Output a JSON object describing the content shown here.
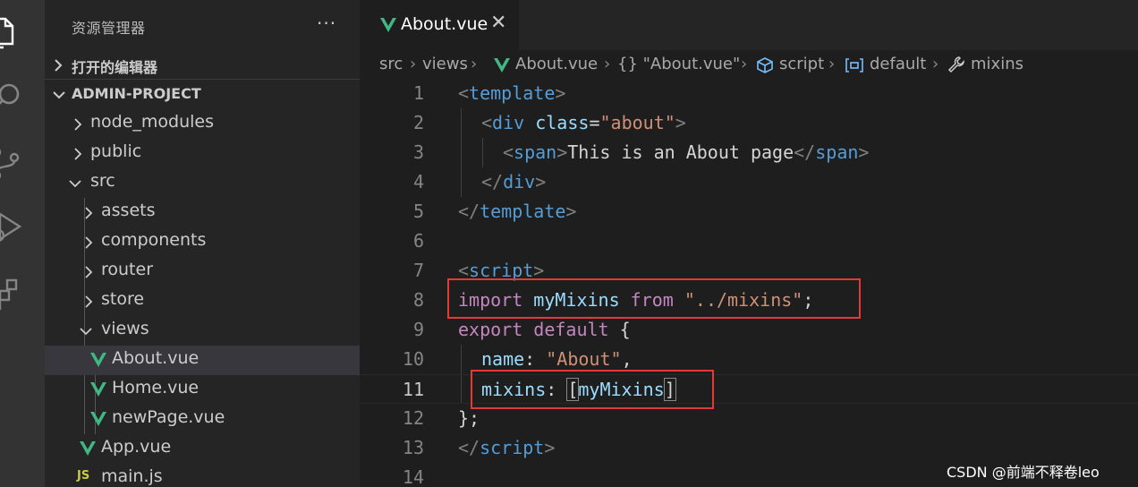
{
  "sidebar": {
    "title": "资源管理器",
    "more": "···",
    "open_editors": "打开的编辑器",
    "project": "ADMIN-PROJECT",
    "tree": [
      {
        "label": "node_modules",
        "type": "folder",
        "expanded": false
      },
      {
        "label": "public",
        "type": "folder",
        "expanded": false
      },
      {
        "label": "src",
        "type": "folder",
        "expanded": true
      },
      {
        "label": "assets",
        "type": "folder",
        "expanded": false
      },
      {
        "label": "components",
        "type": "folder",
        "expanded": false
      },
      {
        "label": "router",
        "type": "folder",
        "expanded": false
      },
      {
        "label": "store",
        "type": "folder",
        "expanded": false
      },
      {
        "label": "views",
        "type": "folder",
        "expanded": true
      },
      {
        "label": "About.vue",
        "type": "vue",
        "selected": true
      },
      {
        "label": "Home.vue",
        "type": "vue"
      },
      {
        "label": "newPage.vue",
        "type": "vue"
      },
      {
        "label": "App.vue",
        "type": "vue"
      },
      {
        "label": "main.js",
        "type": "js",
        "badge": "JS"
      }
    ]
  },
  "tab": {
    "label": "About.vue",
    "close": "✕"
  },
  "breadcrumbs": {
    "items": [
      "src",
      "views",
      "About.vue",
      "{} \"About.vue\"",
      "script",
      "default",
      "mixins"
    ],
    "separator": "›"
  },
  "code": {
    "line_numbers": [
      "1",
      "2",
      "3",
      "4",
      "5",
      "6",
      "7",
      "8",
      "9",
      "10",
      "11",
      "12",
      "13",
      "14"
    ],
    "current_line": "11",
    "l1": {
      "open": "<",
      "tag": "template",
      "close": ">"
    },
    "l2": {
      "open": "<",
      "tag": "div",
      "attr": "class",
      "eq": "=",
      "val": "\"about\"",
      "close": ">"
    },
    "l3": {
      "open": "<",
      "tag": "span",
      "close": ">",
      "text": "This is an About page",
      "open2": "</",
      "tag2": "span",
      "close2": ">"
    },
    "l4": {
      "open": "</",
      "tag": "div",
      "close": ">"
    },
    "l5": {
      "open": "</",
      "tag": "template",
      "close": ">"
    },
    "l7": {
      "open": "<",
      "tag": "script",
      "close": ">"
    },
    "l8": {
      "kw1": "import",
      "var": "myMixins",
      "kw2": "from",
      "str": "\"../mixins\"",
      "semi": ";"
    },
    "l9": {
      "kw1": "export",
      "kw2": "default",
      "brace": "{"
    },
    "l10": {
      "prop": "name",
      "colon": ":",
      "str": "\"About\"",
      "comma": ","
    },
    "l11": {
      "prop": "mixins",
      "colon": ":",
      "lb": "[",
      "var": "myMixins",
      "rb": "]"
    },
    "l12": {
      "text": "};"
    },
    "l13": {
      "open": "</",
      "tag": "script",
      "close": ">"
    }
  },
  "watermark": "CSDN @前端不释卷leo",
  "colors": {
    "highlight_box": "#e53935",
    "vue_icon": "#41b883",
    "js_badge": "#cbcb41"
  }
}
